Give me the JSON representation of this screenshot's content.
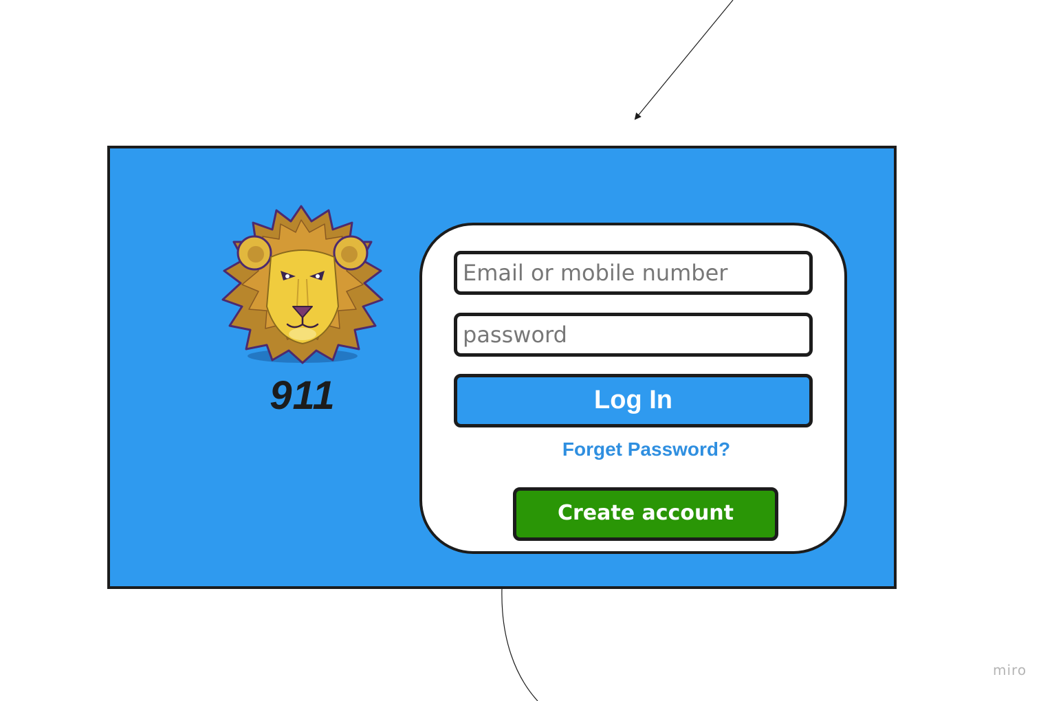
{
  "login_screen": {
    "brand_name": "911",
    "logo_icon": "lion-head-icon",
    "email_placeholder": "Email or mobile number",
    "password_placeholder": "password",
    "login_label": "Log In",
    "forgot_label": "Forget Password?",
    "create_label": "Create account"
  },
  "board": {
    "watermark": "miro"
  },
  "colors": {
    "frame_background": "#2f9aef",
    "border": "#1c1c1c",
    "login_button": "#2f9aef",
    "create_button": "#2a9606",
    "link": "#2f8fe0",
    "placeholder": "#777777"
  }
}
